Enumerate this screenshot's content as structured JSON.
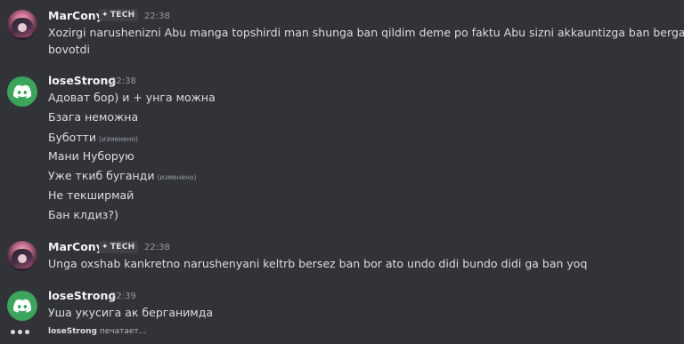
{
  "messages": [
    {
      "author": "MarCony",
      "tag": "TECH",
      "time": "22:38",
      "lines": [
        "Xozirgi narushenizni Abu manga topshirdi man shunga ban qildim deme po faktu Abu sizni akkauntizga ban bergan",
        "bovotdi"
      ]
    },
    {
      "author": "loseStrong",
      "time": "22:38",
      "lines": [
        "Адоват бор) и + унга можна",
        "Бзага неможна",
        "Буботти",
        "Мани Нуборую",
        "Уже ткиб буганди",
        "Не текширмай",
        "Бан клдиз?)"
      ],
      "edited_label": "(изменено)"
    },
    {
      "author": "MarCony",
      "tag": "TECH",
      "time": "22:38",
      "lines": [
        "Unga oxshab kankretno narushenyani keltrb bersez ban bor ato undo didi bundo didi ga ban yoq"
      ]
    },
    {
      "author": "loseStrong",
      "time": "22:39",
      "lines": [
        "Уша укусига ак берганимда"
      ]
    }
  ],
  "typing": {
    "user": "loseStrong",
    "text": "печатает..."
  },
  "colors": {
    "background": "#313338",
    "discord_green": "#3ba55c"
  },
  "icons": {
    "anime_avatar": "anime-avatar",
    "discord_avatar": "discord-logo-icon",
    "tag_icon": "sparkle-icon",
    "typing": "typing-dots-icon"
  }
}
